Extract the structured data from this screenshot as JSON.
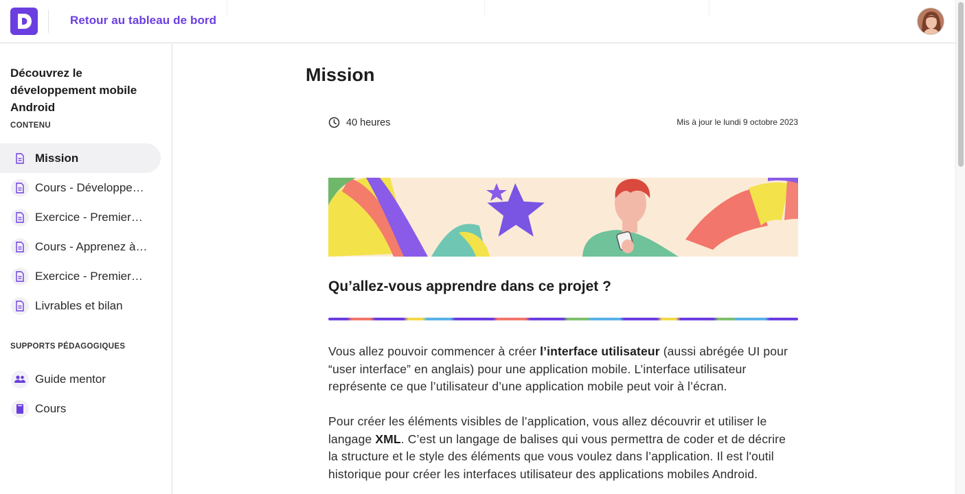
{
  "topbar": {
    "back_label": "Retour au tableau de bord"
  },
  "sidebar": {
    "course_title": "Découvrez le développement mobile Android",
    "content_heading": "CONTENU",
    "content_items": [
      {
        "label": "Mission",
        "icon": "document-icon",
        "active": true
      },
      {
        "label": "Cours - Développez une application",
        "icon": "document-icon"
      },
      {
        "label": "Exercice - Premiers pas",
        "icon": "document-icon"
      },
      {
        "label": "Cours - Apprenez à coder",
        "icon": "document-icon"
      },
      {
        "label": "Exercice - Premiers pas",
        "icon": "document-icon"
      },
      {
        "label": "Livrables et bilan",
        "icon": "document-icon"
      }
    ],
    "supports_heading": "SUPPORTS PÉDAGOGIQUES",
    "support_items": [
      {
        "label": "Guide mentor",
        "icon": "people-icon"
      },
      {
        "label": "Cours",
        "icon": "book-icon"
      }
    ]
  },
  "main": {
    "title": "Mission",
    "duration": "40 heures",
    "updated": "Mis à jour le lundi 9 octobre 2023",
    "section_title": "Qu’allez-vous apprendre dans ce projet ?",
    "para1": {
      "before": "Vous allez pouvoir commencer à créer ",
      "bold": "l’interface utilisateur",
      "after": " (aussi abrégée UI pour “user interface” en anglais) pour une application mobile. L’interface utilisateur représente ce que l’utilisateur d’une application mobile peut voir à l’écran."
    },
    "para2": {
      "before": "Pour créer les éléments visibles de l’application, vous allez découvrir et utiliser le langage ",
      "bold": "XML",
      "after": ". C’est un langage de balises qui vous permettra de coder et de décrire la structure et le style des éléments que vous voulez dans l’application. Il est l'outil historique pour créer les interfaces utilisateur des applications mobiles Android."
    }
  },
  "colors": {
    "brand": "#6b3ee0",
    "text": "#1c1c1c",
    "active_bg": "#f1f1f4"
  }
}
